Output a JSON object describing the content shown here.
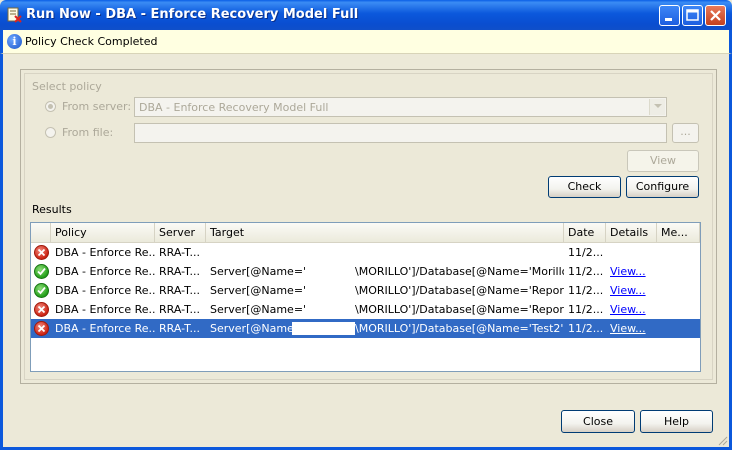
{
  "window": {
    "title": "Run Now - DBA - Enforce Recovery Model Full",
    "controls": [
      "minimize",
      "maximize",
      "close"
    ]
  },
  "infobar": {
    "icon": "info-icon",
    "text": "Policy Check Completed"
  },
  "select_policy": {
    "group_label": "Select policy",
    "from_server_label": "From server:",
    "from_server_value": "DBA - Enforce Recovery Model Full",
    "from_file_label": "From file:",
    "from_file_value": "",
    "browse_label": "...",
    "view_label": "View"
  },
  "actions": {
    "check_label": "Check",
    "configure_label": "Configure"
  },
  "results": {
    "label": "Results",
    "columns": [
      "Policy",
      "Server",
      "Target",
      "Date",
      "Details",
      "Me..."
    ],
    "rows": [
      {
        "status": "fail",
        "policy": "DBA - Enforce Re...",
        "server": "RRA-T...",
        "target_a": "",
        "target_b": "",
        "date": "11/2...",
        "details": ""
      },
      {
        "status": "ok",
        "policy": "DBA - Enforce Re...",
        "server": "RRA-T...",
        "target_a": "Server[@Name='",
        "target_b": "\\MORILLO']/Database[@Name='MorilloDB']",
        "date": "11/2...",
        "details": "View..."
      },
      {
        "status": "ok",
        "policy": "DBA - Enforce Re...",
        "server": "RRA-T...",
        "target_a": "Server[@Name='",
        "target_b": "\\MORILLO']/Database[@Name='Report...",
        "date": "11/2...",
        "details": "View..."
      },
      {
        "status": "fail",
        "policy": "DBA - Enforce Re...",
        "server": "RRA-T...",
        "target_a": "Server[@Name='",
        "target_b": "\\MORILLO']/Database[@Name='Report...",
        "date": "11/2...",
        "details": "View..."
      },
      {
        "status": "fail",
        "policy": "DBA - Enforce Re...",
        "server": "RRA-T...",
        "target_a": "Server[@Name='",
        "target_b": "\\MORILLO']/Database[@Name='Test2']",
        "date": "11/2...",
        "details": "View...",
        "selected": true
      }
    ]
  },
  "footer": {
    "close_label": "Close",
    "help_label": "Help"
  },
  "colors": {
    "titlebar": "#0b58dc",
    "selection": "#316ac5",
    "infobar_bg": "#ffffe1",
    "fail": "#cc2414",
    "ok": "#24a01a"
  }
}
